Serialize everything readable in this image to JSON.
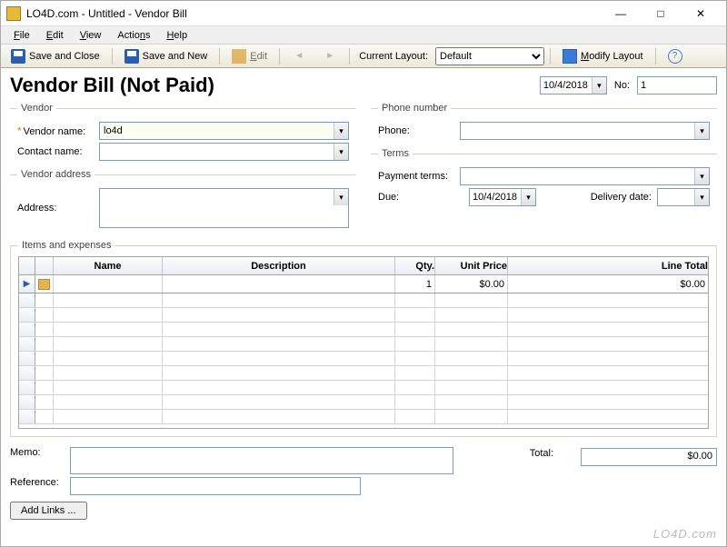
{
  "window": {
    "title": "LO4D.com - Untitled - Vendor Bill"
  },
  "menu": {
    "file": "File",
    "edit": "Edit",
    "view": "View",
    "actions": "Actions",
    "help": "Help"
  },
  "toolbar": {
    "save_close": "Save and Close",
    "save_new": "Save and New",
    "edit": "Edit",
    "current_layout_label": "Current Layout:",
    "layout_value": "Default",
    "modify_layout": "Modify Layout"
  },
  "header": {
    "title": "Vendor Bill (Not Paid)",
    "date": "10/4/2018",
    "no_label": "No:",
    "no_value": "1"
  },
  "vendor": {
    "legend": "Vendor",
    "name_label": "Vendor name:",
    "name_value": "lo4d",
    "contact_label": "Contact name:",
    "contact_value": ""
  },
  "vendor_address": {
    "legend": "Vendor address",
    "address_label": "Address:",
    "address_value": ""
  },
  "phone": {
    "legend": "Phone number",
    "phone_label": "Phone:",
    "phone_value": ""
  },
  "terms": {
    "legend": "Terms",
    "payment_label": "Payment terms:",
    "payment_value": "",
    "due_label": "Due:",
    "due_value": "10/4/2018",
    "delivery_label": "Delivery date:",
    "delivery_value": ""
  },
  "items": {
    "legend": "Items and expenses",
    "cols": {
      "name": "Name",
      "desc": "Description",
      "qty": "Qty.",
      "unit_price": "Unit Price",
      "line_total": "Line Total"
    },
    "rows": [
      {
        "name": "",
        "desc": "",
        "qty": "1",
        "unit_price": "$0.00",
        "line_total": "$0.00"
      }
    ]
  },
  "bottom": {
    "memo_label": "Memo:",
    "memo_value": "",
    "reference_label": "Reference:",
    "reference_value": "",
    "add_links": "Add Links ...",
    "total_label": "Total:",
    "total_value": "$0.00"
  },
  "watermark": "LO4D.com"
}
